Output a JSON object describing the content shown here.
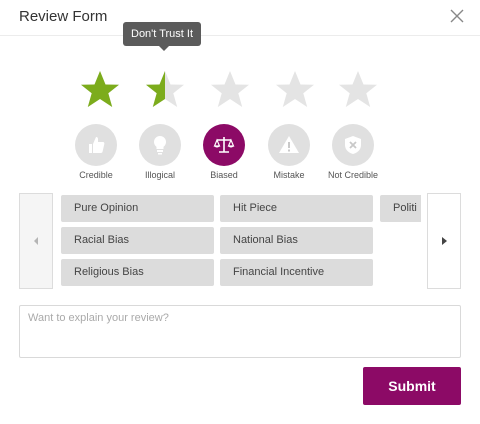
{
  "header": {
    "title": "Review Form",
    "close_icon": "close-icon"
  },
  "tooltip": {
    "text": "Don't Trust It"
  },
  "rating": {
    "value": 1.5,
    "max": 5,
    "colors": {
      "filled": "#7cac1c",
      "empty": "#e4e4e4"
    }
  },
  "categories": [
    {
      "label": "Credible",
      "icon": "thumbs-up-icon",
      "selected": false
    },
    {
      "label": "Illogical",
      "icon": "lightbulb-icon",
      "selected": false
    },
    {
      "label": "Biased",
      "icon": "scales-icon",
      "selected": true
    },
    {
      "label": "Mistake",
      "icon": "warning-icon",
      "selected": false
    },
    {
      "label": "Not Credible",
      "icon": "shield-x-icon",
      "selected": false
    }
  ],
  "tags": [
    {
      "label": "Pure Opinion"
    },
    {
      "label": "Hit Piece"
    },
    {
      "label": "Politi"
    },
    {
      "label": "Racial Bias"
    },
    {
      "label": "National Bias"
    },
    {
      "label": "Religious Bias"
    },
    {
      "label": "Financial Incentive"
    }
  ],
  "explain": {
    "placeholder": "Want to explain your review?",
    "value": ""
  },
  "submit_label": "Submit",
  "accent_color": "#8c0a66"
}
